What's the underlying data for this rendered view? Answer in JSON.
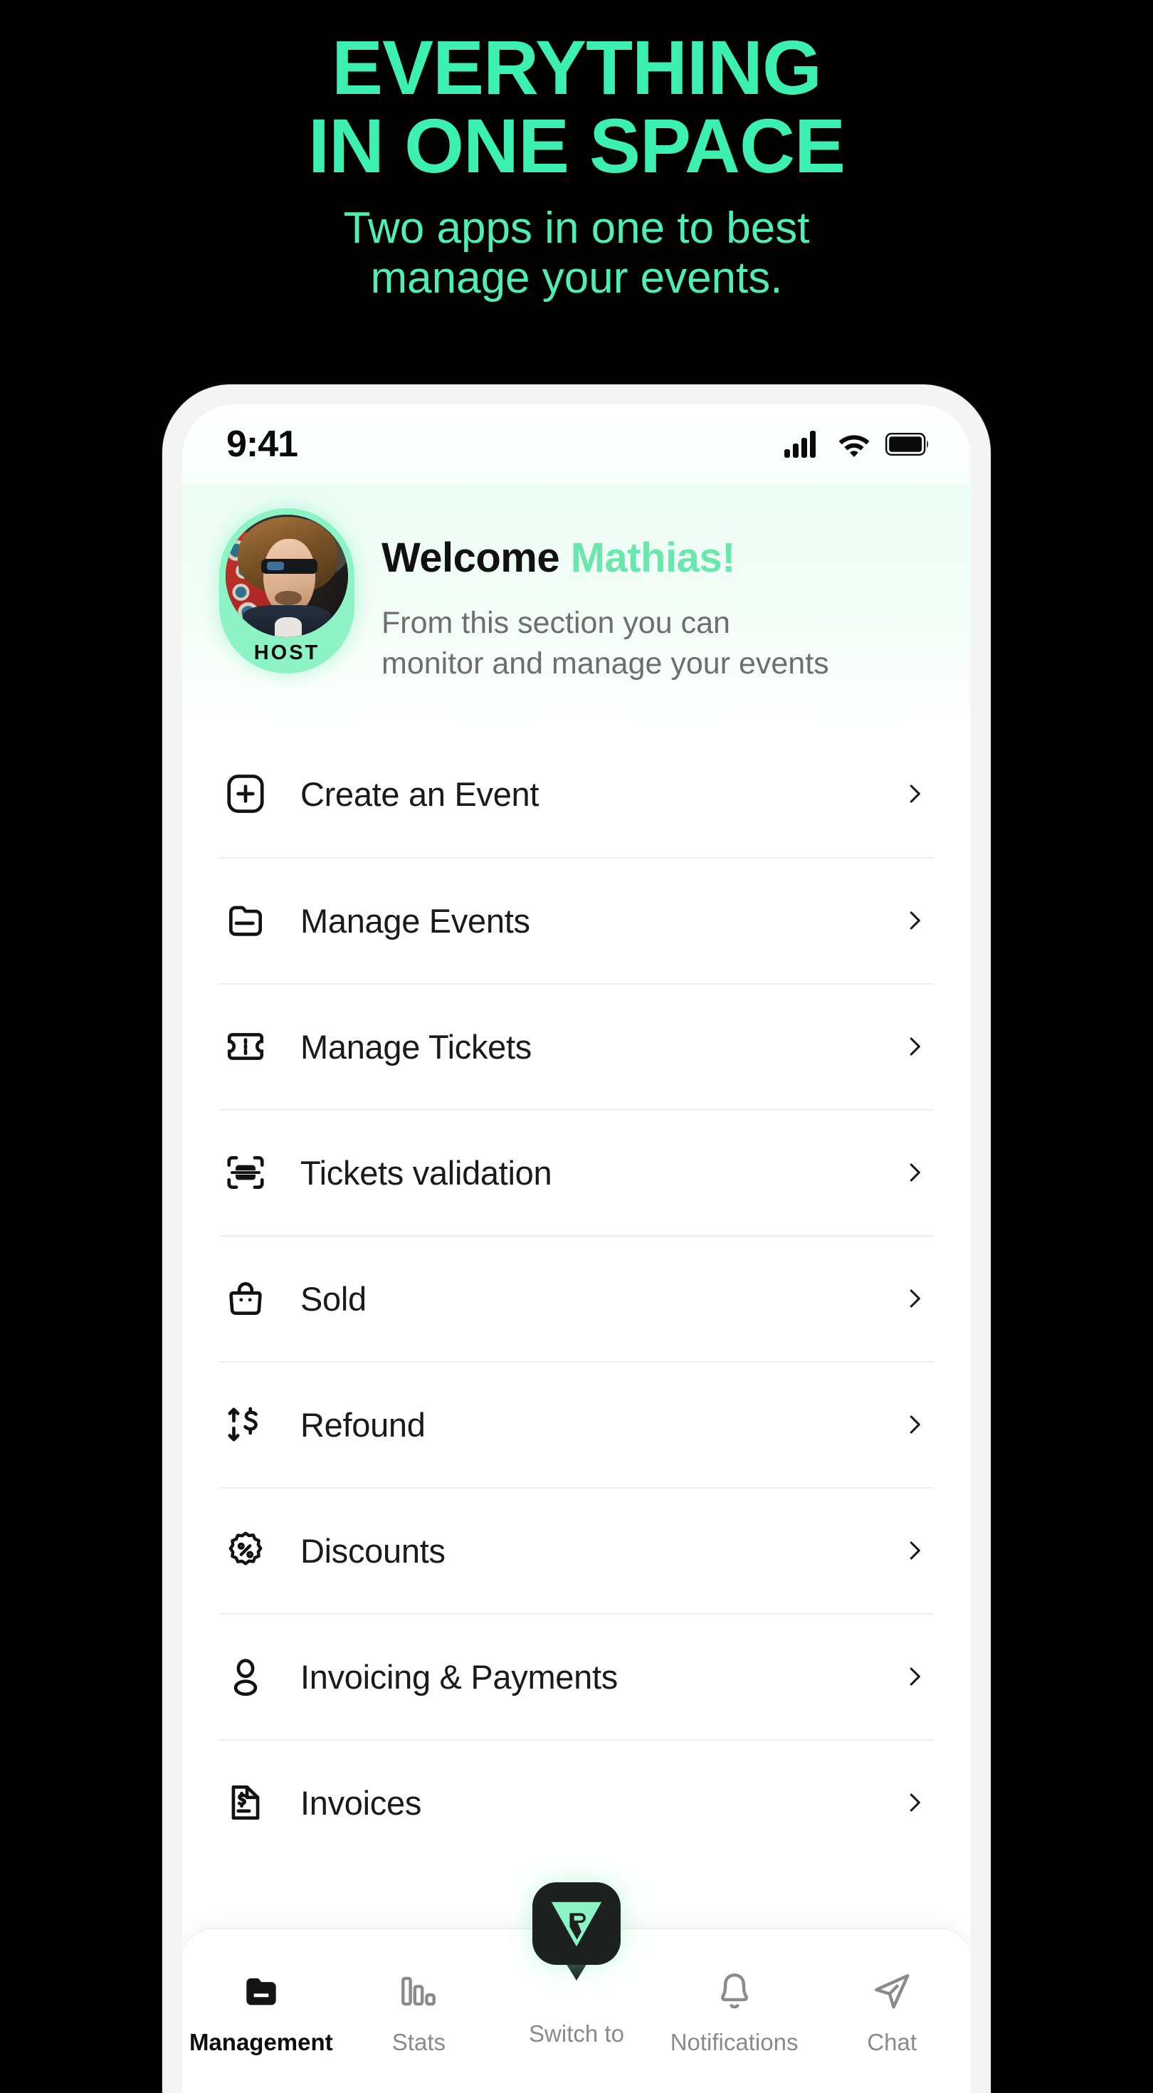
{
  "promo": {
    "title_line1": "EVERYTHING",
    "title_line2": "IN ONE SPACE",
    "subtitle_line1": "Two apps in one to best",
    "subtitle_line2": "manage your events.",
    "accent_color": "#3BF0B0",
    "subtitle_color": "#4FEEB4",
    "background_color": "#000000"
  },
  "statusbar": {
    "time": "9:41",
    "cellular_icon": "signal-bars-icon",
    "wifi_icon": "wifi-icon",
    "battery_icon": "battery-icon"
  },
  "welcome": {
    "greeting": "Welcome ",
    "name": "Mathias!",
    "description_line1": "From this section you can",
    "description_line2": "monitor and manage your events",
    "badge": "HOST",
    "badge_color": "#8EF3C4",
    "avatar_icon": "user-avatar-photo"
  },
  "menu": {
    "items": [
      {
        "label": "Create an Event",
        "icon": "plus-square-icon"
      },
      {
        "label": "Manage Events",
        "icon": "folder-minus-icon"
      },
      {
        "label": "Manage Tickets",
        "icon": "ticket-icon"
      },
      {
        "label": "Tickets validation",
        "icon": "scan-ticket-icon"
      },
      {
        "label": "Sold",
        "icon": "shopping-bag-icon"
      },
      {
        "label": "Refound",
        "icon": "transfer-dollar-icon"
      },
      {
        "label": "Discounts",
        "icon": "percent-badge-icon"
      },
      {
        "label": "Invoicing & Payments",
        "icon": "user-icon"
      },
      {
        "label": "Invoices",
        "icon": "document-dollar-icon"
      }
    ],
    "chevron_icon": "chevron-right-icon"
  },
  "tabbar": {
    "items": [
      {
        "label": "Management",
        "icon": "folder-minus-icon",
        "active": true
      },
      {
        "label": "Stats",
        "icon": "bar-chart-icon",
        "active": false
      },
      {
        "label": "Switch to",
        "icon": "app-logo-icon",
        "active": false
      },
      {
        "label": "Notifications",
        "icon": "bell-icon",
        "active": false
      },
      {
        "label": "Chat",
        "icon": "send-paperplane-icon",
        "active": false
      }
    ],
    "fab_bg_color": "#1C211F",
    "fab_logo_color": "#8EF3C4"
  }
}
